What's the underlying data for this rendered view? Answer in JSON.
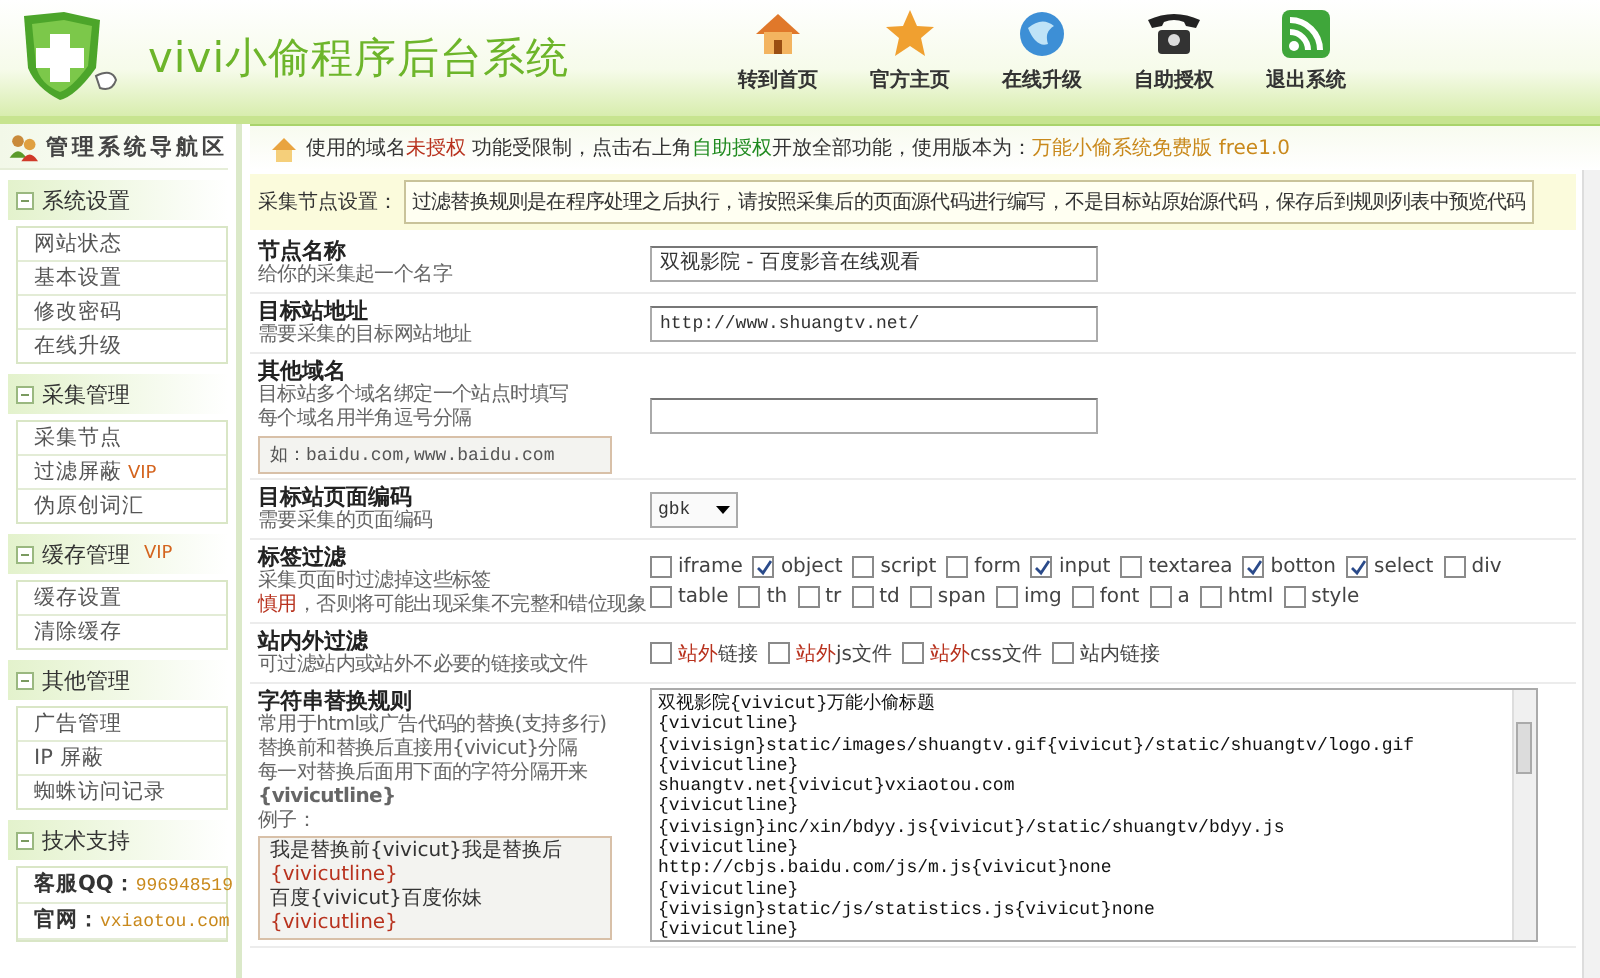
{
  "header": {
    "title": "vivi小偷程序后台系统",
    "nav": [
      {
        "label": "转到首页"
      },
      {
        "label": "官方主页"
      },
      {
        "label": "在线升级"
      },
      {
        "label": "自助授权"
      },
      {
        "label": "退出系统"
      }
    ]
  },
  "sidebar": {
    "heading": "管理系统导航区",
    "sections": [
      {
        "title": "系统设置",
        "items": [
          {
            "kind": "link",
            "label": "网站状态"
          },
          {
            "kind": "link",
            "label": "基本设置"
          },
          {
            "kind": "link",
            "label": "修改密码"
          },
          {
            "kind": "link",
            "label": "在线升级"
          }
        ]
      },
      {
        "title": "采集管理",
        "items": [
          {
            "kind": "link",
            "label": "采集节点"
          },
          {
            "kind": "link",
            "label": "过滤屏蔽",
            "badge": "VIP"
          },
          {
            "kind": "link",
            "label": "伪原创词汇"
          }
        ]
      },
      {
        "title": "缓存管理",
        "badge": "VIP",
        "items": [
          {
            "kind": "link",
            "label": "缓存设置"
          },
          {
            "kind": "link",
            "label": "清除缓存"
          }
        ]
      },
      {
        "title": "其他管理",
        "items": [
          {
            "kind": "link",
            "label": "广告管理"
          },
          {
            "kind": "link",
            "label": "IP 屏蔽"
          },
          {
            "kind": "link",
            "label": "蜘蛛访问记录"
          }
        ]
      },
      {
        "title": "技术支持",
        "items": [
          {
            "kind": "contact",
            "label": "客服QQ：",
            "value": "996948519"
          },
          {
            "kind": "contact",
            "label": "官网：",
            "value": "vxiaotou.com"
          }
        ]
      }
    ]
  },
  "main": {
    "notice": [
      {
        "text": "使用的域名"
      },
      {
        "text": "未授权",
        "color": "#b8321e"
      },
      {
        "text": " 功能受限制，点击右上角"
      },
      {
        "text": "自助授权",
        "color": "#1f8a1f"
      },
      {
        "text": "开放全部功能，使用版本为："
      },
      {
        "text": "万能小偷系统免费版",
        "color": "#c9891c"
      },
      {
        "text": " free1.0",
        "color": "#c9891c"
      }
    ],
    "setting_label": "采集节点设置：",
    "setting_text": "过滤替换规则是在程序处理之后执行，请按照采集后的页面源代码进行编写，不是目标站原始源代码，保存后到规则列表中预览代码",
    "rows": [
      {
        "kind": "text",
        "title": "节点名称",
        "hints": [
          "给你的采集起一个名字"
        ],
        "value": "双视影院 - 百度影音在线观看"
      },
      {
        "kind": "text",
        "title": "目标站地址",
        "hints": [
          "需要采集的目标网站地址"
        ],
        "value": "http://www.shuangtv.net/"
      },
      {
        "kind": "text",
        "title": "其他域名",
        "hints": [
          "目标站多个域名绑定一个站点时填写",
          "每个域名用半角逗号分隔"
        ],
        "example": "如：baidu.com,www.baidu.com"
      },
      {
        "kind": "select",
        "title": "目标站页面编码",
        "hints": [
          "需要采集的页面编码"
        ],
        "value": "gbk"
      },
      {
        "kind": "checks",
        "title": "标签过滤",
        "hints": [
          "采集页面时过滤掉这些标签",
          [
            {
              "text": "慎用",
              "color": "#b8321e"
            },
            {
              "text": "，否则将可能出现采集不完整和错位现象"
            }
          ]
        ],
        "options": [
          {
            "label": "iframe",
            "checked": false
          },
          {
            "label": "object",
            "checked": true
          },
          {
            "label": "script",
            "checked": false
          },
          {
            "label": "form",
            "checked": false
          },
          {
            "label": "input",
            "checked": true
          },
          {
            "label": "textarea",
            "checked": false
          },
          {
            "label": "botton",
            "checked": true
          },
          {
            "label": "select",
            "checked": true
          },
          {
            "label": "div",
            "checked": false
          },
          {
            "label": "table",
            "checked": false
          },
          {
            "label": "th",
            "checked": false
          },
          {
            "label": "tr",
            "checked": false
          },
          {
            "label": "td",
            "checked": false
          },
          {
            "label": "span",
            "checked": false
          },
          {
            "label": "img",
            "checked": false
          },
          {
            "label": "font",
            "checked": false
          },
          {
            "label": "a",
            "checked": false
          },
          {
            "label": "html",
            "checked": false
          },
          {
            "label": "style",
            "checked": false
          }
        ]
      },
      {
        "kind": "checks",
        "title": "站内外过滤",
        "hints": [
          "可过滤站内或站外不必要的链接或文件"
        ],
        "options": [
          {
            "highlight": "站外",
            "label": "链接",
            "checked": false
          },
          {
            "highlight": "站外",
            "label": "js文件",
            "checked": false
          },
          {
            "highlight": "站外",
            "label": "css文件",
            "checked": false
          },
          {
            "label": "站内链接",
            "checked": false
          }
        ]
      },
      {
        "kind": "rules",
        "title": "字符串替换规则",
        "hints": [
          "常用于html或广告代码的替换(支持多行)",
          "替换前和替换后直接用{vivicut}分隔",
          "每一对替换后面用下面的字符分隔开来",
          [
            {
              "text": "{vivicutline}",
              "bold": true
            }
          ],
          "例子："
        ],
        "example": [
          {
            "text": "我是替换前{vivicut}我是替换后"
          },
          {
            "text": "{vivicutline}",
            "color": "#b8321e"
          },
          {
            "text": "百度{vivicut}百度你妹"
          },
          {
            "text": "{vivicutline}",
            "color": "#b8321e"
          }
        ],
        "lines": [
          "双视影院{vivicut}万能小偷标题",
          "{vivicutline}",
          "{vivisign}static/images/shuangtv.gif{vivicut}/static/shuangtv/logo.gif",
          "{vivicutline}",
          "shuangtv.net{vivicut}vxiaotou.com",
          "{vivicutline}",
          "{vivisign}inc/xin/bdyy.js{vivicut}/static/shuangtv/bdyy.js",
          "{vivicutline}",
          "http://cbjs.baidu.com/js/m.js{vivicut}none",
          "{vivicutline}",
          "{vivisign}static/js/statistics.js{vivicut}none",
          "{vivicutline}"
        ]
      }
    ]
  }
}
